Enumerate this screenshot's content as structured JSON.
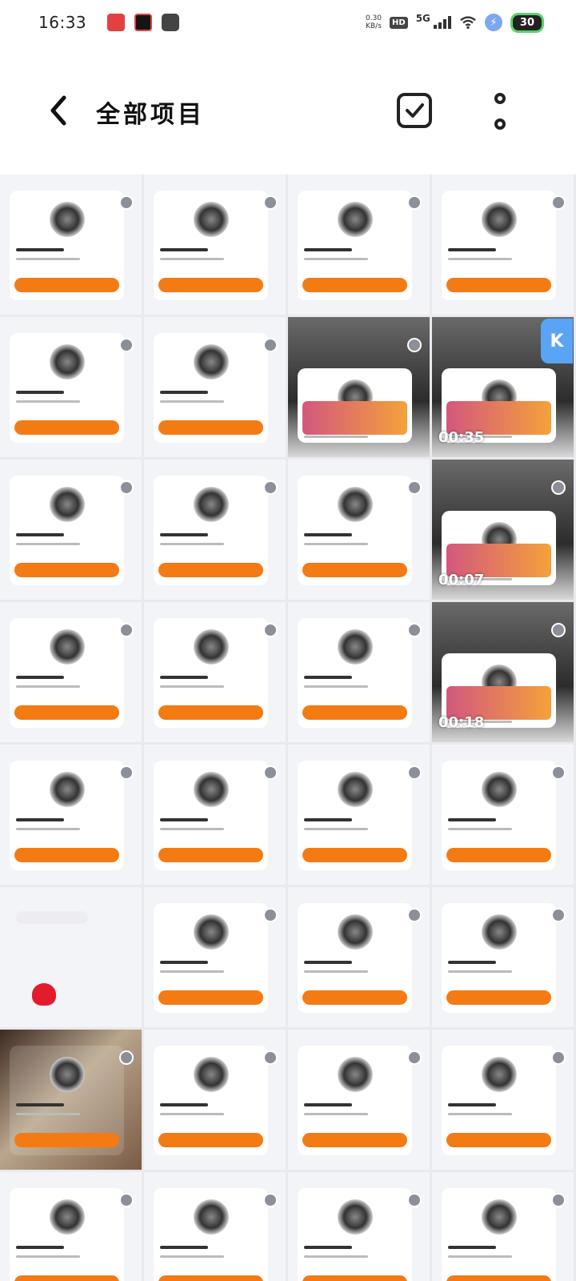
{
  "status_bar": {
    "time": "16:33",
    "net_speed_value": "0.30",
    "net_speed_unit": "KB/s",
    "hd": "HD",
    "network": "5G",
    "battery": "30"
  },
  "app_bar": {
    "title": "全部项目",
    "back_icon": "chevron-left-icon",
    "select_icon": "checkbox-icon",
    "more_icon": "more-vertical-icon"
  },
  "grid": {
    "tiles": [
      {
        "kind": "card"
      },
      {
        "kind": "card"
      },
      {
        "kind": "card"
      },
      {
        "kind": "card"
      },
      {
        "kind": "card"
      },
      {
        "kind": "card"
      },
      {
        "kind": "video",
        "duration": ""
      },
      {
        "kind": "video",
        "duration": "00:35"
      },
      {
        "kind": "card"
      },
      {
        "kind": "card"
      },
      {
        "kind": "card"
      },
      {
        "kind": "video",
        "duration": "00:07"
      },
      {
        "kind": "card"
      },
      {
        "kind": "card"
      },
      {
        "kind": "card"
      },
      {
        "kind": "video",
        "duration": "00:18"
      },
      {
        "kind": "card"
      },
      {
        "kind": "card"
      },
      {
        "kind": "card"
      },
      {
        "kind": "card"
      },
      {
        "kind": "chat"
      },
      {
        "kind": "card"
      },
      {
        "kind": "card"
      },
      {
        "kind": "card"
      },
      {
        "kind": "photo"
      },
      {
        "kind": "card"
      },
      {
        "kind": "card"
      },
      {
        "kind": "card"
      },
      {
        "kind": "card"
      },
      {
        "kind": "card"
      },
      {
        "kind": "card"
      },
      {
        "kind": "card"
      }
    ]
  },
  "floating_button": {
    "label": "K"
  },
  "colors": {
    "accent": "#f47a14",
    "tile_bg": "#f3f4f7",
    "grid_gap": "#e9e9ee"
  }
}
